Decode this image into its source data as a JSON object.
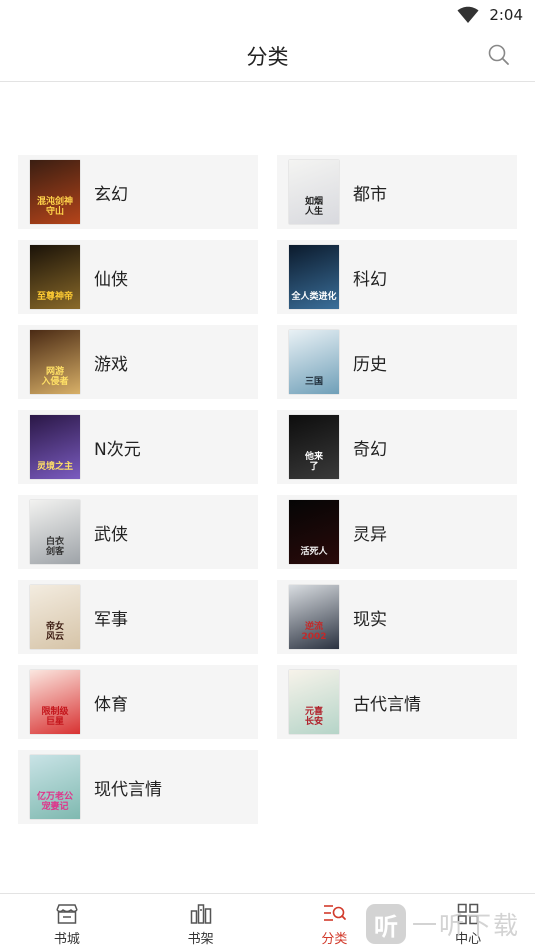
{
  "status_bar": {
    "time": "2:04"
  },
  "header": {
    "title": "分类"
  },
  "categories": [
    {
      "label": "玄幻",
      "cover_title": "混沌剑神\n守山",
      "cover_colors": [
        "#3a1e12",
        "#b5441a"
      ],
      "title_color": "#ffd34a"
    },
    {
      "label": "都市",
      "cover_title": "如烟\n人生",
      "cover_colors": [
        "#f4f4f2",
        "#d8d9de"
      ],
      "title_color": "#222222"
    },
    {
      "label": "仙侠",
      "cover_title": "至尊神帝",
      "cover_colors": [
        "#1a1208",
        "#8a6a2a"
      ],
      "title_color": "#ffcc33"
    },
    {
      "label": "科幻",
      "cover_title": "全人类进化",
      "cover_colors": [
        "#0b1a2c",
        "#3b6f9a"
      ],
      "title_color": "#ffffff"
    },
    {
      "label": "游戏",
      "cover_title": "网游\n入侵者",
      "cover_colors": [
        "#4a2a14",
        "#d8b068"
      ],
      "title_color": "#ffe066"
    },
    {
      "label": "历史",
      "cover_title": "三国",
      "cover_colors": [
        "#e9f1f5",
        "#6f9fb8"
      ],
      "title_color": "#1c2a36"
    },
    {
      "label": "N次元",
      "cover_title": "灵境之主",
      "cover_colors": [
        "#2a1746",
        "#7b5cc0"
      ],
      "title_color": "#ffe066"
    },
    {
      "label": "奇幻",
      "cover_title": "他来\n了",
      "cover_colors": [
        "#0d0d0d",
        "#3a3a3a"
      ],
      "title_color": "#ffffff"
    },
    {
      "label": "武侠",
      "cover_title": "白衣\n剑客",
      "cover_colors": [
        "#f2f2f0",
        "#9ea3a8"
      ],
      "title_color": "#333333"
    },
    {
      "label": "灵异",
      "cover_title": "活死人",
      "cover_colors": [
        "#050505",
        "#2a0a0a"
      ],
      "title_color": "#f2f2f2"
    },
    {
      "label": "军事",
      "cover_title": "帝女\n风云",
      "cover_colors": [
        "#f3ece0",
        "#d6c4a8"
      ],
      "title_color": "#3a1a10"
    },
    {
      "label": "现实",
      "cover_title": "逆流\n2002",
      "cover_colors": [
        "#d9dde1",
        "#2b3240"
      ],
      "title_color": "#c22a2a"
    },
    {
      "label": "体育",
      "cover_title": "限制级\n巨星",
      "cover_colors": [
        "#fbe7e0",
        "#d83232"
      ],
      "title_color": "#c4161c"
    },
    {
      "label": "古代言情",
      "cover_title": "元喜\n长安",
      "cover_colors": [
        "#f7f3ea",
        "#b5d4c8"
      ],
      "title_color": "#b0202a"
    },
    {
      "label": "现代言情",
      "cover_title": "亿万老公\n宠妻记",
      "cover_colors": [
        "#c9e3e6",
        "#7fb9b0"
      ],
      "title_color": "#e0338a"
    }
  ],
  "bottom_nav": {
    "items": [
      {
        "label": "书城",
        "icon": "bookstore-icon",
        "active": false
      },
      {
        "label": "书架",
        "icon": "bookshelf-icon",
        "active": false
      },
      {
        "label": "分类",
        "icon": "category-icon",
        "active": true
      },
      {
        "label": "中心",
        "icon": "user-center-icon",
        "active": false
      }
    ]
  },
  "watermark": {
    "badge": "听",
    "text": "一听下载"
  },
  "colors": {
    "accent": "#d23a2b",
    "card_bg": "#f5f5f5",
    "divider": "#e3e3e3"
  }
}
